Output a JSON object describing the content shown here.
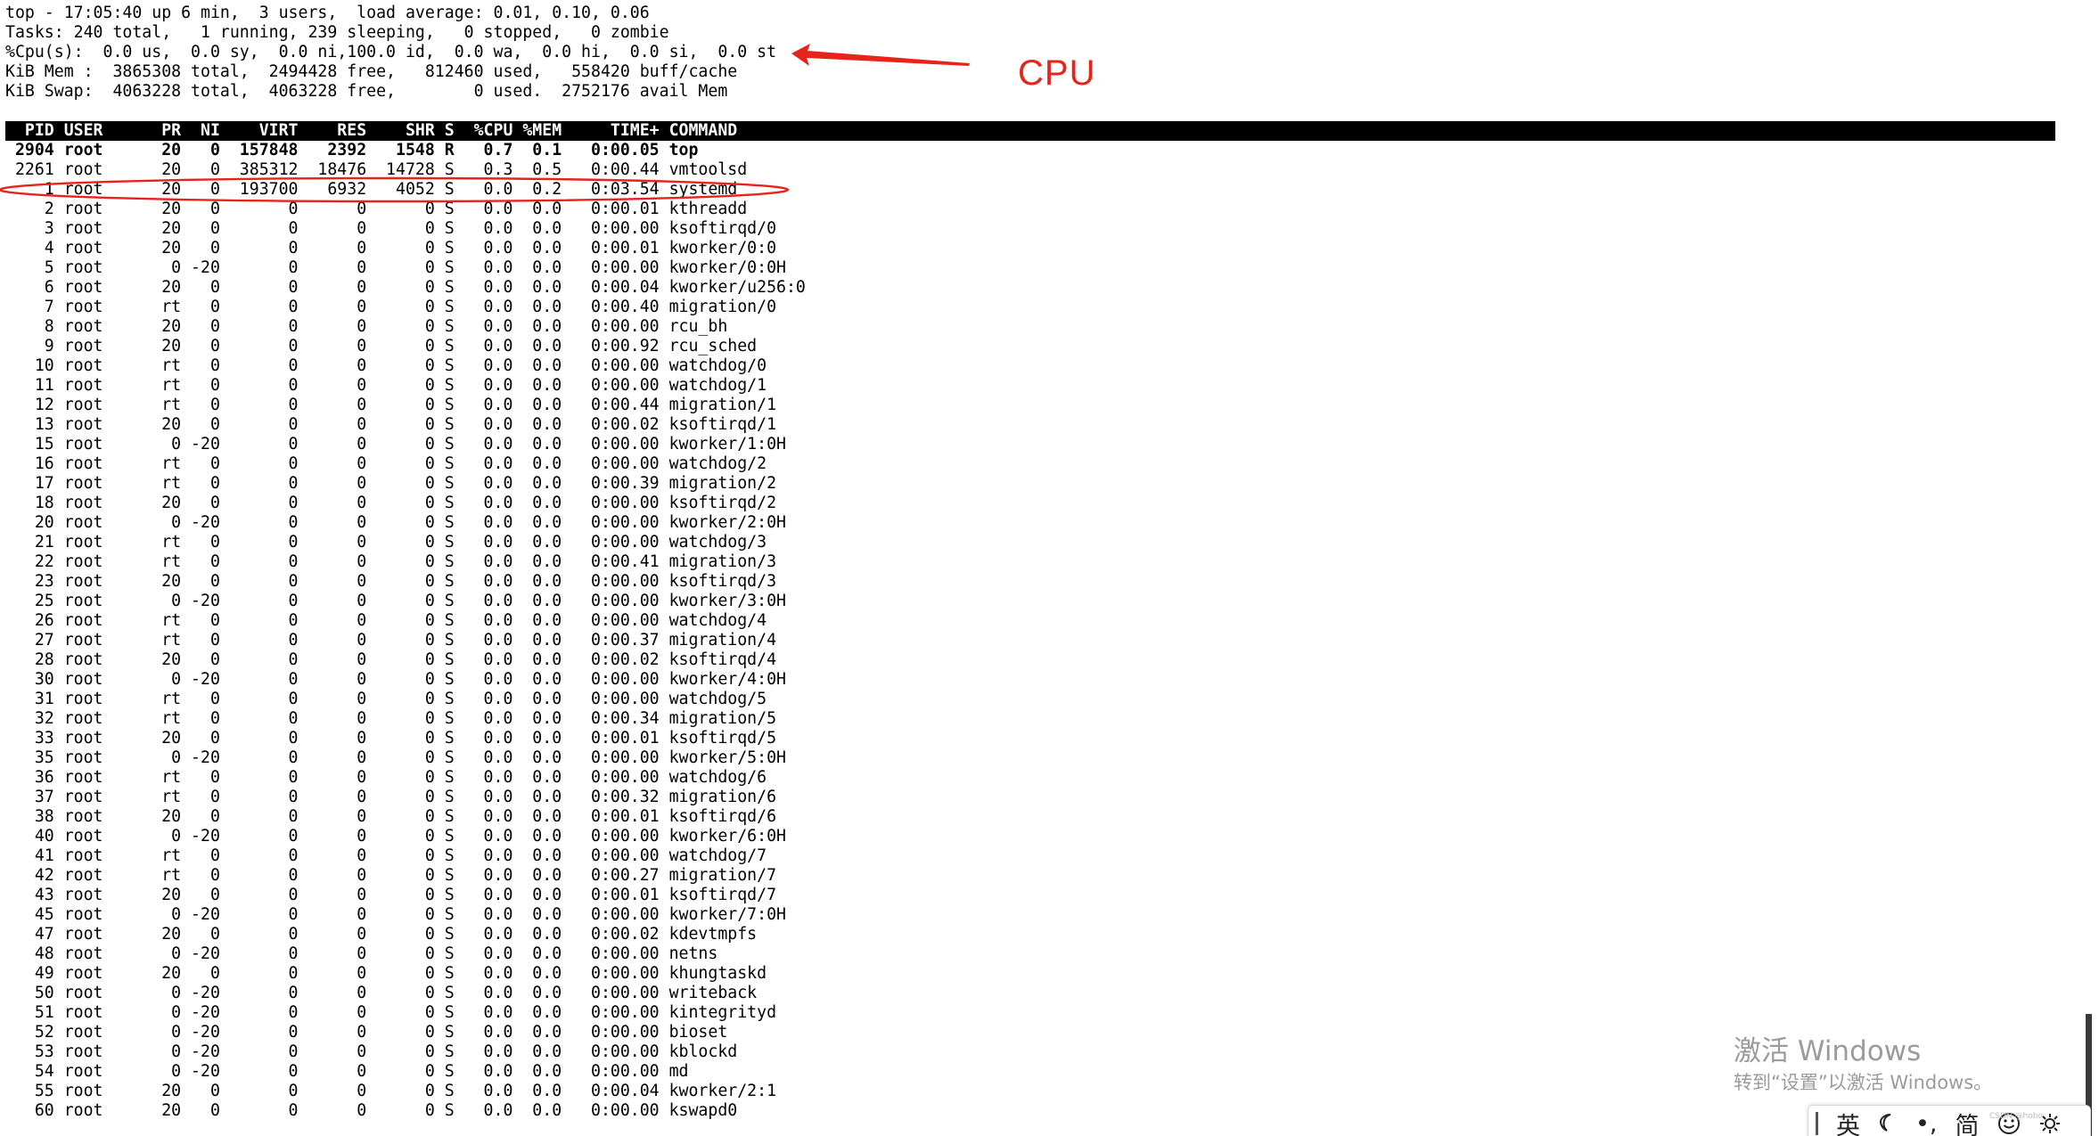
{
  "summary": [
    "top - 17:05:40 up 6 min,  3 users,  load average: 0.01, 0.10, 0.06",
    "Tasks: 240 total,   1 running, 239 sleeping,   0 stopped,   0 zombie",
    "%Cpu(s):  0.0 us,  0.0 sy,  0.0 ni,100.0 id,  0.0 wa,  0.0 hi,  0.0 si,  0.0 st",
    "KiB Mem :  3865308 total,  2494428 free,   812460 used,   558420 buff/cache",
    "KiB Swap:  4063228 total,  4063228 free,        0 used.  2752176 avail Mem"
  ],
  "header": "  PID USER      PR  NI    VIRT    RES    SHR S  %CPU %MEM     TIME+ COMMAND",
  "rows": [
    {
      "text": " 2904 root      20   0  157848   2392   1548 R   0.7  0.1   0:00.05 top",
      "bold": true
    },
    {
      "text": " 2261 root      20   0  385312  18476  14728 S   0.3  0.5   0:00.44 vmtoolsd",
      "bold": false
    },
    {
      "text": "    1 root      20   0  193700   6932   4052 S   0.0  0.2   0:03.54 systemd",
      "bold": false
    },
    {
      "text": "    2 root      20   0       0      0      0 S   0.0  0.0   0:00.01 kthreadd",
      "bold": false
    },
    {
      "text": "    3 root      20   0       0      0      0 S   0.0  0.0   0:00.00 ksoftirqd/0",
      "bold": false
    },
    {
      "text": "    4 root      20   0       0      0      0 S   0.0  0.0   0:00.01 kworker/0:0",
      "bold": false
    },
    {
      "text": "    5 root       0 -20       0      0      0 S   0.0  0.0   0:00.00 kworker/0:0H",
      "bold": false
    },
    {
      "text": "    6 root      20   0       0      0      0 S   0.0  0.0   0:00.04 kworker/u256:0",
      "bold": false
    },
    {
      "text": "    7 root      rt   0       0      0      0 S   0.0  0.0   0:00.40 migration/0",
      "bold": false
    },
    {
      "text": "    8 root      20   0       0      0      0 S   0.0  0.0   0:00.00 rcu_bh",
      "bold": false
    },
    {
      "text": "    9 root      20   0       0      0      0 S   0.0  0.0   0:00.92 rcu_sched",
      "bold": false
    },
    {
      "text": "   10 root      rt   0       0      0      0 S   0.0  0.0   0:00.00 watchdog/0",
      "bold": false
    },
    {
      "text": "   11 root      rt   0       0      0      0 S   0.0  0.0   0:00.00 watchdog/1",
      "bold": false
    },
    {
      "text": "   12 root      rt   0       0      0      0 S   0.0  0.0   0:00.44 migration/1",
      "bold": false
    },
    {
      "text": "   13 root      20   0       0      0      0 S   0.0  0.0   0:00.02 ksoftirqd/1",
      "bold": false
    },
    {
      "text": "   15 root       0 -20       0      0      0 S   0.0  0.0   0:00.00 kworker/1:0H",
      "bold": false
    },
    {
      "text": "   16 root      rt   0       0      0      0 S   0.0  0.0   0:00.00 watchdog/2",
      "bold": false
    },
    {
      "text": "   17 root      rt   0       0      0      0 S   0.0  0.0   0:00.39 migration/2",
      "bold": false
    },
    {
      "text": "   18 root      20   0       0      0      0 S   0.0  0.0   0:00.00 ksoftirqd/2",
      "bold": false
    },
    {
      "text": "   20 root       0 -20       0      0      0 S   0.0  0.0   0:00.00 kworker/2:0H",
      "bold": false
    },
    {
      "text": "   21 root      rt   0       0      0      0 S   0.0  0.0   0:00.00 watchdog/3",
      "bold": false
    },
    {
      "text": "   22 root      rt   0       0      0      0 S   0.0  0.0   0:00.41 migration/3",
      "bold": false
    },
    {
      "text": "   23 root      20   0       0      0      0 S   0.0  0.0   0:00.00 ksoftirqd/3",
      "bold": false
    },
    {
      "text": "   25 root       0 -20       0      0      0 S   0.0  0.0   0:00.00 kworker/3:0H",
      "bold": false
    },
    {
      "text": "   26 root      rt   0       0      0      0 S   0.0  0.0   0:00.00 watchdog/4",
      "bold": false
    },
    {
      "text": "   27 root      rt   0       0      0      0 S   0.0  0.0   0:00.37 migration/4",
      "bold": false
    },
    {
      "text": "   28 root      20   0       0      0      0 S   0.0  0.0   0:00.02 ksoftirqd/4",
      "bold": false
    },
    {
      "text": "   30 root       0 -20       0      0      0 S   0.0  0.0   0:00.00 kworker/4:0H",
      "bold": false
    },
    {
      "text": "   31 root      rt   0       0      0      0 S   0.0  0.0   0:00.00 watchdog/5",
      "bold": false
    },
    {
      "text": "   32 root      rt   0       0      0      0 S   0.0  0.0   0:00.34 migration/5",
      "bold": false
    },
    {
      "text": "   33 root      20   0       0      0      0 S   0.0  0.0   0:00.01 ksoftirqd/5",
      "bold": false
    },
    {
      "text": "   35 root       0 -20       0      0      0 S   0.0  0.0   0:00.00 kworker/5:0H",
      "bold": false
    },
    {
      "text": "   36 root      rt   0       0      0      0 S   0.0  0.0   0:00.00 watchdog/6",
      "bold": false
    },
    {
      "text": "   37 root      rt   0       0      0      0 S   0.0  0.0   0:00.32 migration/6",
      "bold": false
    },
    {
      "text": "   38 root      20   0       0      0      0 S   0.0  0.0   0:00.01 ksoftirqd/6",
      "bold": false
    },
    {
      "text": "   40 root       0 -20       0      0      0 S   0.0  0.0   0:00.00 kworker/6:0H",
      "bold": false
    },
    {
      "text": "   41 root      rt   0       0      0      0 S   0.0  0.0   0:00.00 watchdog/7",
      "bold": false
    },
    {
      "text": "   42 root      rt   0       0      0      0 S   0.0  0.0   0:00.27 migration/7",
      "bold": false
    },
    {
      "text": "   43 root      20   0       0      0      0 S   0.0  0.0   0:00.01 ksoftirqd/7",
      "bold": false
    },
    {
      "text": "   45 root       0 -20       0      0      0 S   0.0  0.0   0:00.00 kworker/7:0H",
      "bold": false
    },
    {
      "text": "   47 root      20   0       0      0      0 S   0.0  0.0   0:00.02 kdevtmpfs",
      "bold": false
    },
    {
      "text": "   48 root       0 -20       0      0      0 S   0.0  0.0   0:00.00 netns",
      "bold": false
    },
    {
      "text": "   49 root      20   0       0      0      0 S   0.0  0.0   0:00.00 khungtaskd",
      "bold": false
    },
    {
      "text": "   50 root       0 -20       0      0      0 S   0.0  0.0   0:00.00 writeback",
      "bold": false
    },
    {
      "text": "   51 root       0 -20       0      0      0 S   0.0  0.0   0:00.00 kintegrityd",
      "bold": false
    },
    {
      "text": "   52 root       0 -20       0      0      0 S   0.0  0.0   0:00.00 bioset",
      "bold": false
    },
    {
      "text": "   53 root       0 -20       0      0      0 S   0.0  0.0   0:00.00 kblockd",
      "bold": false
    },
    {
      "text": "   54 root       0 -20       0      0      0 S   0.0  0.0   0:00.00 md",
      "bold": false
    },
    {
      "text": "   55 root      20   0       0      0      0 S   0.0  0.0   0:00.04 kworker/2:1",
      "bold": false
    },
    {
      "text": "   60 root      20   0       0      0      0 S   0.0  0.0   0:00.00 kswapd0",
      "bold": false
    }
  ],
  "annotation": {
    "label": "CPU",
    "color": "#e8231c"
  },
  "watermark": {
    "title": "激活 Windows",
    "subtitle": "转到“设置”以激活 Windows。"
  },
  "ime": {
    "lang": "英",
    "moon_icon": "crescent-moon-icon",
    "punct": "•,",
    "mode": "简",
    "smiley_icon": "smiley-icon",
    "gear_icon": "gear-icon",
    "tiny_text": "CSDN @hobo"
  }
}
